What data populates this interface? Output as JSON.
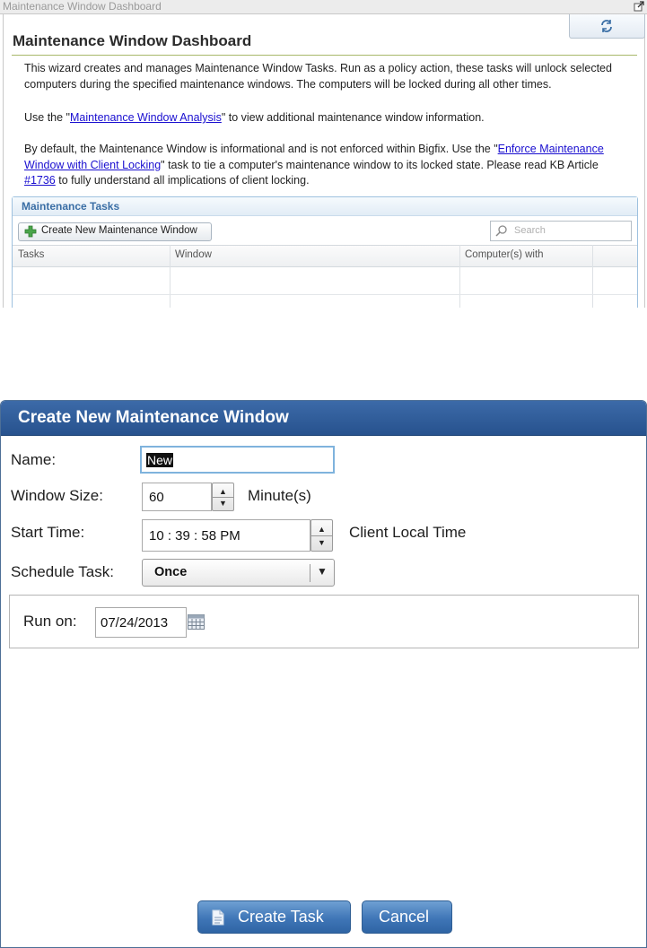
{
  "dashboard": {
    "window_title": "Maintenance Window Dashboard",
    "heading": "Maintenance Window Dashboard",
    "intro": "This wizard creates and manages Maintenance Window Tasks. Run as a policy action, these tasks will unlock selected computers during the specified maintenance windows. The computers will be locked during all other times.",
    "analysis_prefix": "Use the \"",
    "analysis_link": "Maintenance Window Analysis",
    "analysis_suffix": "\" to view additional maintenance window information.",
    "default_prefix": "By default, the Maintenance Window is informational and is not enforced within Bigfix. Use the \"",
    "enforce_link": "Enforce Maintenance Window with Client Locking",
    "default_middle": "\" task to tie a computer's maintenance window to its locked state. Please read KB Article ",
    "kb_link": "#1736",
    "default_suffix": " to fully understand all implications of client locking.",
    "tasks_panel": {
      "title": "Maintenance Tasks",
      "create_button": "Create New Maintenance Window",
      "search_placeholder": "Search",
      "columns": [
        "Tasks",
        "Window",
        "Computer(s) with"
      ]
    }
  },
  "dialog": {
    "title": "Create New Maintenance Window",
    "name_label": "Name:",
    "name_value": "New",
    "window_size_label": "Window Size:",
    "window_size_value": "60",
    "window_size_unit": "Minute(s)",
    "start_time_label": "Start Time:",
    "start_time_value": "10 : 39 : 58 PM",
    "start_time_note": "Client Local Time",
    "schedule_label": "Schedule Task:",
    "schedule_value": "Once",
    "run_on_label": "Run on:",
    "run_on_value": "07/24/2013",
    "create_task_button": "Create Task",
    "cancel_button": "Cancel"
  }
}
